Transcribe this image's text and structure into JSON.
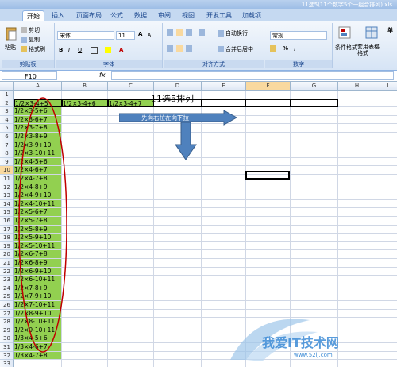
{
  "window": {
    "title": "11选5(11个数字5个一组合排列).xls"
  },
  "tabs": [
    {
      "label": "开始",
      "active": true
    },
    {
      "label": "插入"
    },
    {
      "label": "页面布局"
    },
    {
      "label": "公式"
    },
    {
      "label": "数据"
    },
    {
      "label": "审阅"
    },
    {
      "label": "视图"
    },
    {
      "label": "开发工具"
    },
    {
      "label": "加载项"
    }
  ],
  "ribbon": {
    "clipboard": {
      "label": "剪贴板",
      "paste": "粘贴",
      "cut": "剪切",
      "copy": "复制",
      "format_painter": "格式刷"
    },
    "font": {
      "label": "字体",
      "name": "宋体",
      "size": "11",
      "bold": "B",
      "italic": "I",
      "underline": "U",
      "grow": "A",
      "shrink": "A",
      "color_a": "A"
    },
    "alignment": {
      "label": "对齐方式",
      "wrap": "自动换行",
      "merge": "合并后居中"
    },
    "number": {
      "label": "数字",
      "format": "常规"
    },
    "styles": {
      "conditional": "条件格式",
      "table": "套用表格格式",
      "cell_style": "单"
    }
  },
  "formula_bar": {
    "name_box": "F10",
    "fx": "fx",
    "value": ""
  },
  "columns": [
    "A",
    "B",
    "C",
    "D",
    "E",
    "F",
    "G",
    "H",
    "I"
  ],
  "sheet_title": "11选5排列",
  "row2": [
    "1/2×3-4+5",
    "1/2×3-4+6",
    "1/2×3-4+7"
  ],
  "arrow_note": {
    "prefix": "先向",
    "rest": "先向右拉在向下拉"
  },
  "column_a": [
    "1/2×3-4+5",
    "1/2×3-5+6",
    "1/2×3-6+7",
    "1/2×3-7+8",
    "1/2×3-8+9",
    "1/2×3-9+10",
    "1/2×3-10+11",
    "1/2×4-5+6",
    "1/2×4-6+7",
    "1/2×4-7+8",
    "1/2×4-8+9",
    "1/2×4-9+10",
    "1/2×4-10+11",
    "1/2×5-6+7",
    "1/2×5-7+8",
    "1/2×5-8+9",
    "1/2×5-9+10",
    "1/2×5-10+11",
    "1/2×6-7+8",
    "1/2×6-8+9",
    "1/2×6-9+10",
    "1/2×6-10+11",
    "1/2×7-8+9",
    "1/2×7-9+10",
    "1/2×7-10+11",
    "1/2×8-9+10",
    "1/2×8-10+11",
    "1/2×9-10+11",
    "1/3×4-5+6",
    "1/3×4-6+7",
    "1/3×4-7+8"
  ],
  "row_numbers": [
    "1",
    "2",
    "3",
    "4",
    "5",
    "6",
    "7",
    "8",
    "9",
    "10",
    "11",
    "12",
    "13",
    "14",
    "15",
    "16",
    "17",
    "18",
    "19",
    "20",
    "21",
    "22",
    "23",
    "24",
    "25",
    "26",
    "27",
    "28",
    "29",
    "30",
    "31",
    "32",
    "33"
  ],
  "watermark": "我爱IT技术网",
  "watermark_url": "www.52ij.com",
  "colors": {
    "green": "#92d050",
    "arrow": "#4f81bd",
    "oval": "#c00000"
  }
}
